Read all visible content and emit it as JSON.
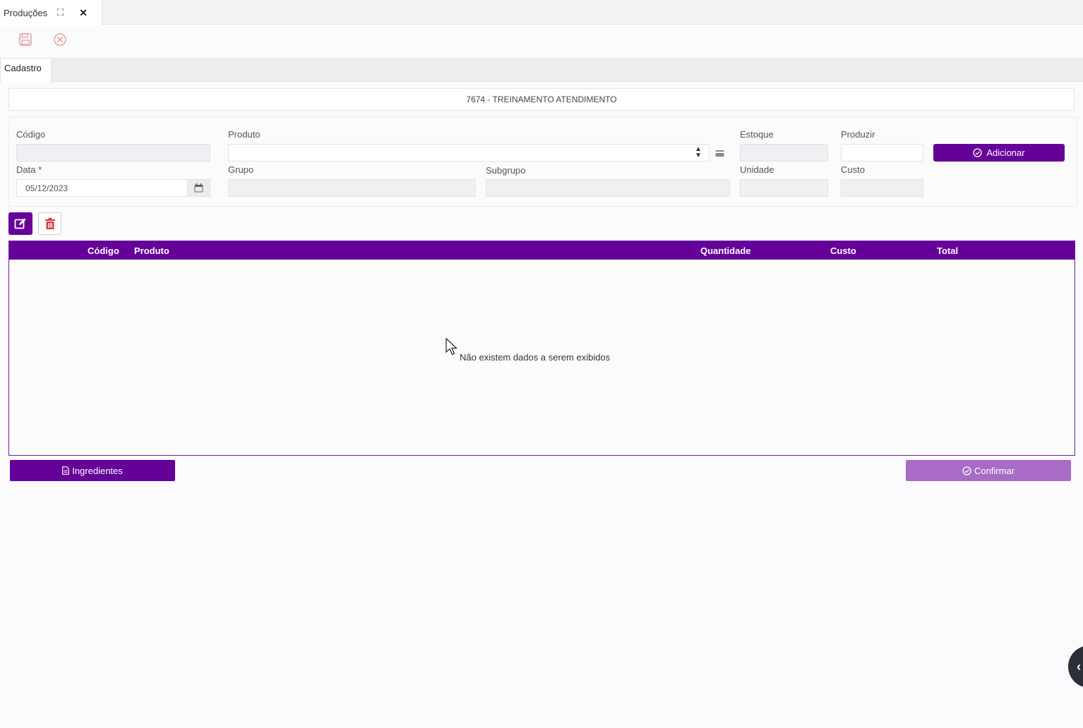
{
  "window_tab": {
    "title": "Produções",
    "expand_icon": "expand-icon",
    "close_icon": "close-icon"
  },
  "toolbar": {
    "save_icon": "save-icon",
    "cancel_icon": "cancel-icon"
  },
  "tabs": [
    {
      "label": "Cadastro",
      "active": true
    }
  ],
  "header": {
    "title": "7674 - TREINAMENTO ATENDIMENTO"
  },
  "form": {
    "codigo_label": "Código",
    "codigo_value": "",
    "produto_label": "Produto",
    "produto_value": "",
    "estoque_label": "Estoque",
    "estoque_value": "",
    "produzir_label": "Produzir",
    "produzir_value": "",
    "adicionar_label": "Adicionar",
    "data_label": "Data",
    "data_required_mark": "*",
    "data_value": "05/12/2023",
    "grupo_label": "Grupo",
    "grupo_value": "",
    "subgrupo_label": "Subgrupo",
    "subgrupo_value": "",
    "unidade_label": "Unidade",
    "unidade_value": "",
    "custo_label": "Custo",
    "custo_value": ""
  },
  "grid": {
    "columns": [
      "Código",
      "Produto",
      "Quantidade",
      "Custo",
      "Total"
    ],
    "rows": [],
    "empty_message": "Não existem dados a serem exibidos"
  },
  "footer": {
    "ingredientes_label": "Ingredientes",
    "confirmar_label": "Confirmar"
  },
  "colors": {
    "accent": "#650099",
    "accent_disabled": "#a86cc7",
    "required": "#c0392b"
  }
}
